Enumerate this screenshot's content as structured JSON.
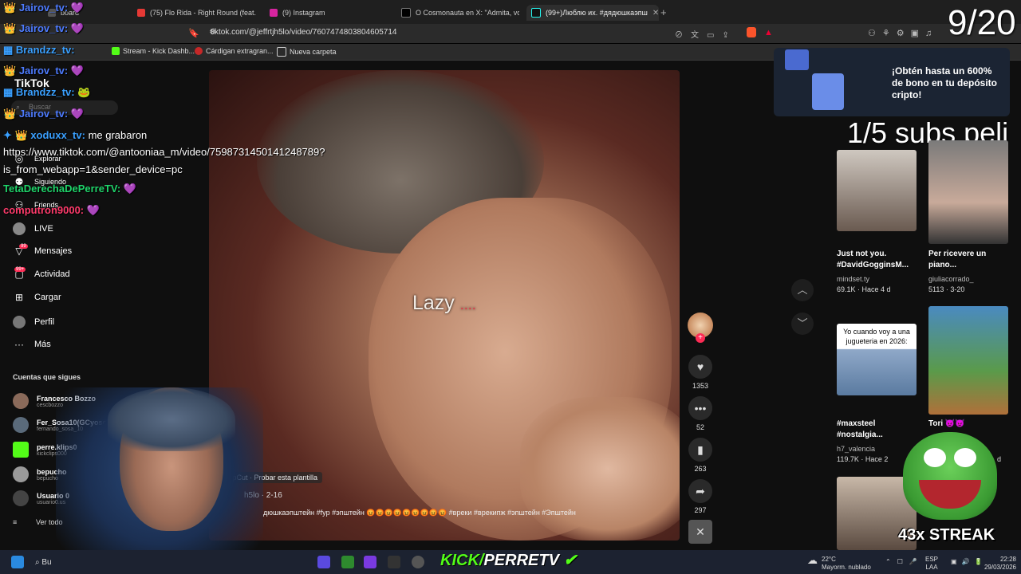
{
  "browser": {
    "tabs": [
      {
        "title": "board",
        "active": false
      },
      {
        "title": "(75) Flo Rida - Right Round (feat. Ke$",
        "active": false
      },
      {
        "title": "(9) Instagram",
        "active": false
      },
      {
        "title": "O Cosmonauta en X: \"Admita, você c",
        "active": false
      },
      {
        "title": "(99+)Люблю их. #дядюшкаэпш",
        "active": true
      }
    ],
    "url": "tiktok.com/@jeffrtjh5lo/video/7607474803804605714",
    "bookmarks": [
      "Stream - Kick Dashb...",
      "Cárdigan extragran...",
      "Nueva carpeta"
    ]
  },
  "overlay": {
    "counter": "9/20",
    "subs_goal": "1/5 subs peli",
    "streak": "43x STREAK",
    "kick_brand": "KICK/",
    "kick_user": "PERRETV"
  },
  "chat": [
    {
      "user": "Jairov_tv:",
      "msg": ""
    },
    {
      "user": "Jairov_tv:",
      "msg": ""
    },
    {
      "user": "Brandzz_tv:",
      "msg": ""
    },
    {
      "user": "Jairov_tv:",
      "msg": ""
    },
    {
      "user": "Brandzz_tv:",
      "msg": ""
    },
    {
      "user": "Jairov_tv:",
      "msg": ""
    },
    {
      "user": "xoduxx_tv:",
      "msg": "me grabaron"
    },
    {
      "user": "",
      "msg": "https://www.tiktok.com/@antooniaa_m/video/7598731450141248789?"
    },
    {
      "user": "",
      "msg": "is_from_webapp=1&sender_device=pc"
    },
    {
      "user": "TetaDerechaDePerreTV:",
      "msg": ""
    },
    {
      "user": "computron9000:",
      "msg": ""
    }
  ],
  "tiktok": {
    "logo": "TikTok",
    "search_placeholder": "Buscar",
    "nav": [
      {
        "label": "Explorar",
        "icon": "compass-icon"
      },
      {
        "label": "Siguiendo",
        "icon": "following-icon"
      },
      {
        "label": "Friends",
        "icon": "friends-icon"
      },
      {
        "label": "LIVE",
        "icon": "live-icon"
      },
      {
        "label": "Mensajes",
        "icon": "messages-icon",
        "badge": "99"
      },
      {
        "label": "Actividad",
        "icon": "activity-icon",
        "badge": "99+"
      },
      {
        "label": "Cargar",
        "icon": "upload-icon"
      },
      {
        "label": "Perfil",
        "icon": "profile-icon"
      },
      {
        "label": "Más",
        "icon": "more-icon"
      }
    ],
    "following_title": "Cuentas que sigues",
    "following": [
      {
        "name": "Francesco Bozzo",
        "handle": "cescbozzo"
      },
      {
        "name": "Fer_Sosa10(GCyosoy)",
        "handle": "fernando_sosa_10"
      },
      {
        "name": "perre.klips0",
        "handle": "kickclips000"
      },
      {
        "name": "bepucho",
        "handle": "bepucho"
      },
      {
        "name": "Usuario 0",
        "handle": "usuario0.us"
      }
    ],
    "see_all": "Ver todo"
  },
  "video": {
    "caption": "Lazy",
    "caption_dots": "....",
    "capcut": "CapCut · Probar esta plantilla",
    "author": "h5lo · 2-16",
    "description": "дюшкаэпштейн #fyp #эпштейн 😡😡😡😡😡😡😡😡😡 #вреки #врекипж #эпштейн #Эпштейн",
    "likes": "1353",
    "comments": "52",
    "saves": "263",
    "shares": "297"
  },
  "ad": {
    "text": "¡Obtén hasta un 600% de bono en tu depósito cripto!"
  },
  "grid": [
    {
      "title": "Just not you. #DavidGogginsM...",
      "author": "mindset.ty",
      "stat": "69.1K · Hace 4 d"
    },
    {
      "title": "Per ricevere un piano...",
      "author": "giuliacorrado_",
      "stat": "5113 · 3-20"
    },
    {
      "title": "#maxsteel #nostalgia...",
      "author": "h7_valencia",
      "stat": "119.7K · Hace 2",
      "thumb_text": "Yo cuando voy a una jugueteria en 2026:"
    },
    {
      "title": "Tori 😈😈",
      "author": "",
      "stat": "d"
    }
  ],
  "taskbar": {
    "search": "Bu",
    "temp": "22°C",
    "weather": "Mayorm. nublado",
    "lang": "ESP",
    "lang2": "LAA",
    "time": "22:28",
    "date": "29/03/2026"
  }
}
